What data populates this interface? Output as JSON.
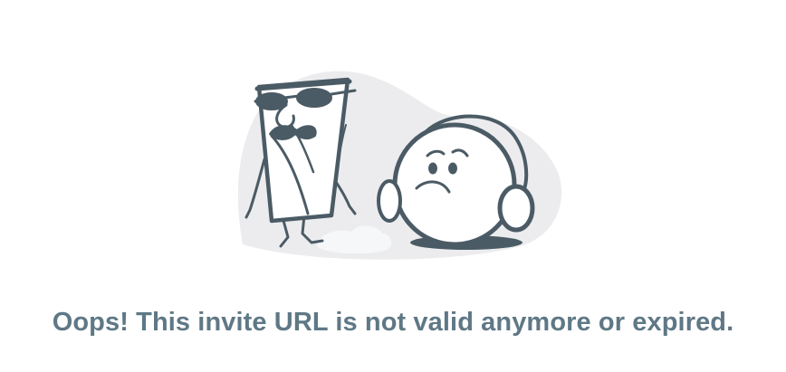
{
  "error": {
    "message": "Oops! This invite URL is not valid anymore or expired."
  },
  "illustration": {
    "name": "expired-invite-illustration",
    "colors": {
      "backdrop": "#ececee",
      "outline": "#4b5b65",
      "dust": "#f4f5f6",
      "shadow": "#4b5b65"
    }
  }
}
